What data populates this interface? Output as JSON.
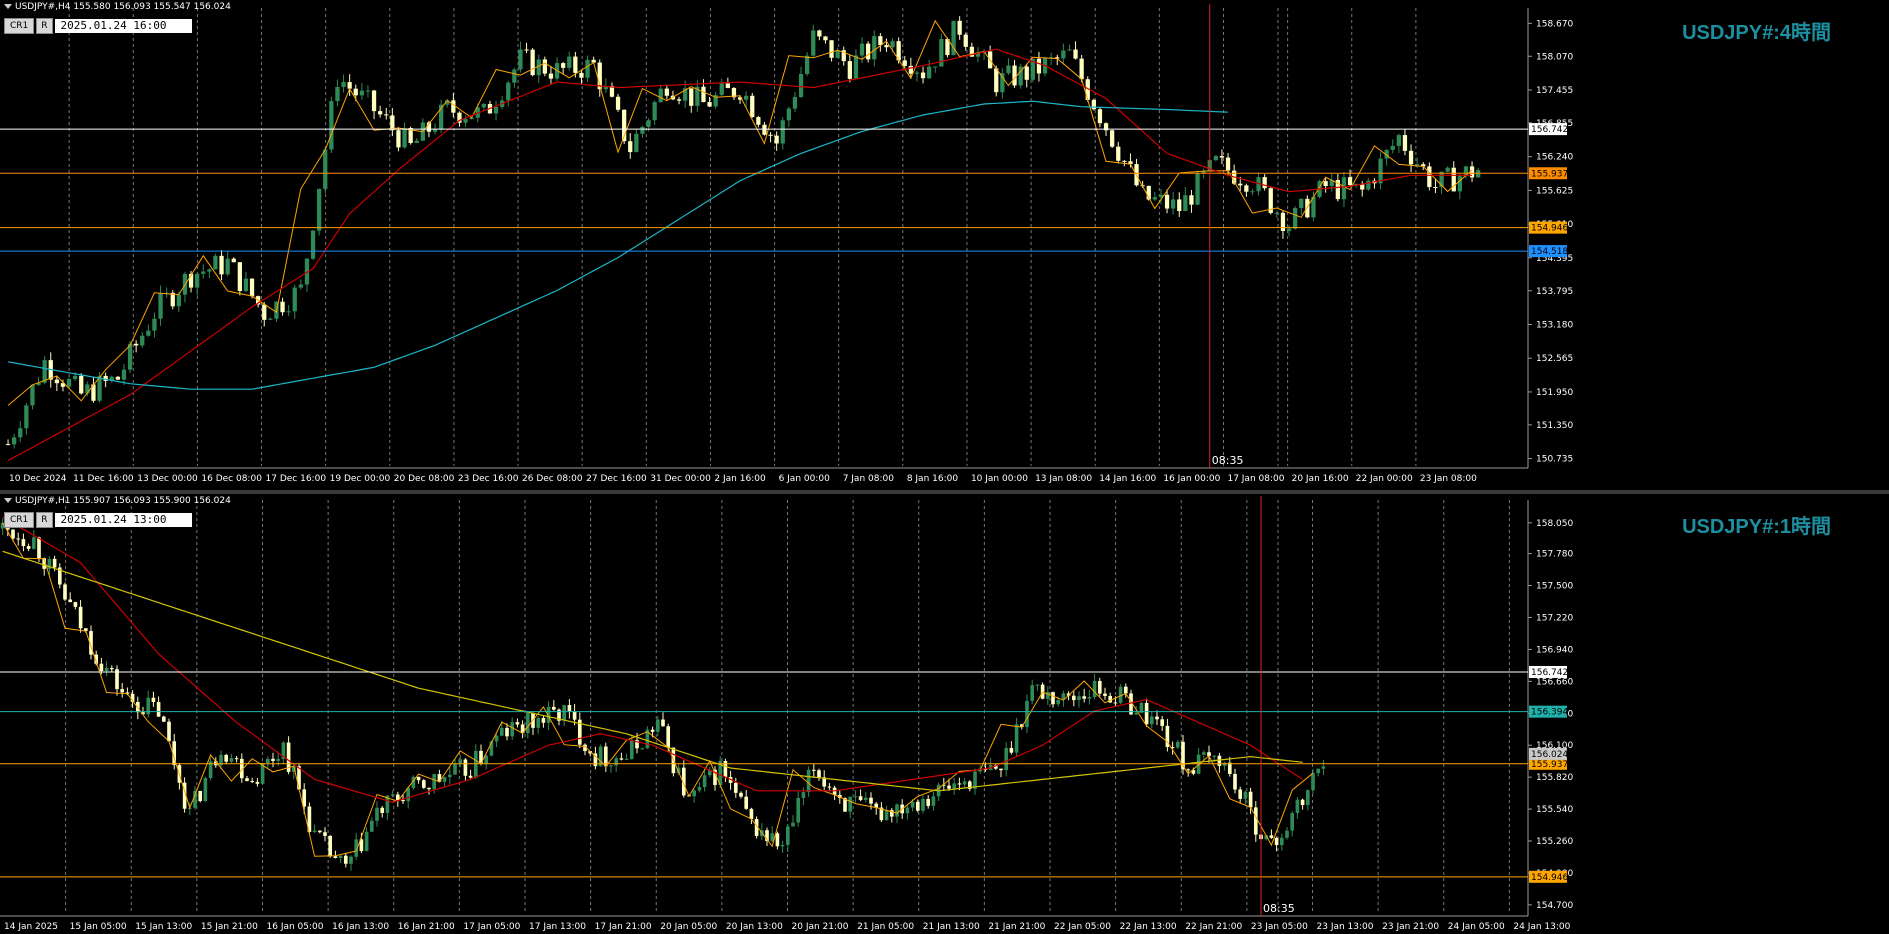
{
  "colors": {
    "bull": "#2e8b57",
    "bear": "#ffffc0",
    "zig": "#ffa500",
    "ma_red": "#cc0000",
    "ma_cyan": "#1bb6c8",
    "ma_yellow": "#d4c400",
    "grid": "#777777",
    "axis_text": "#ffffff",
    "bg": "#000000"
  },
  "h4": {
    "header": "USDJPY#,H4  155.580 156.093 155.547 156.024",
    "cr_label": "CR1",
    "r_label": "R",
    "datetime": "2025.01.24 16:00",
    "title": "USDJPY#:4時間",
    "cursor_time": "08:35"
  },
  "h1": {
    "header": "USDJPY#,H1  155.907 156.093 155.900 156.024",
    "cr_label": "CR1",
    "r_label": "R",
    "datetime": "2025.01.24 13:00",
    "title": "USDJPY#:1時間",
    "cursor_time": "08:35"
  },
  "chart_data": [
    {
      "type": "candlestick",
      "title": "USDJPY#:4時間",
      "timeframe": "H4",
      "ylim": [
        150.6,
        158.95
      ],
      "y_ticks": [
        158.67,
        158.07,
        157.455,
        156.855,
        156.24,
        155.625,
        155.01,
        154.395,
        153.795,
        153.18,
        152.565,
        151.95,
        151.35,
        150.735
      ],
      "x_ticks": [
        "10 Dec 2024",
        "11 Dec 16:00",
        "13 Dec 00:00",
        "16 Dec 08:00",
        "17 Dec 16:00",
        "19 Dec 00:00",
        "20 Dec 08:00",
        "23 Dec 16:00",
        "26 Dec 08:00",
        "27 Dec 16:00",
        "31 Dec 00:00",
        "2 Jan 16:00",
        "6 Jan 00:00",
        "7 Jan 08:00",
        "8 Jan 16:00",
        "10 Jan 00:00",
        "13 Jan 08:00",
        "14 Jan 16:00",
        "16 Jan 00:00",
        "17 Jan 08:00",
        "20 Jan 16:00",
        "22 Jan 00:00",
        "23 Jan 08:00"
      ],
      "levels": [
        {
          "price": 156.742,
          "label": "156.742",
          "color": "#ffffff"
        },
        {
          "price": 155.937,
          "label": "155.937",
          "color": "#ff8c00"
        },
        {
          "price": 154.946,
          "label": "154.946",
          "color": "#ffa500"
        },
        {
          "price": 154.518,
          "label": "154.518",
          "color": "#1e90ff"
        }
      ],
      "close_path": [
        [
          0,
          151.0
        ],
        [
          6,
          152.5
        ],
        [
          12,
          151.9
        ],
        [
          18,
          152.2
        ],
        [
          24,
          153.4
        ],
        [
          30,
          154.1
        ],
        [
          36,
          154.3
        ],
        [
          42,
          153.4
        ],
        [
          48,
          153.8
        ],
        [
          54,
          157.7
        ],
        [
          60,
          157.1
        ],
        [
          66,
          156.4
        ],
        [
          72,
          157.1
        ],
        [
          78,
          157.0
        ],
        [
          84,
          158.0
        ],
        [
          90,
          157.8
        ],
        [
          96,
          157.9
        ],
        [
          102,
          156.4
        ],
        [
          108,
          157.6
        ],
        [
          114,
          157.2
        ],
        [
          120,
          157.5
        ],
        [
          126,
          156.5
        ],
        [
          132,
          158.4
        ],
        [
          138,
          157.9
        ],
        [
          144,
          158.4
        ],
        [
          150,
          157.8
        ],
        [
          156,
          158.6
        ],
        [
          162,
          157.6
        ],
        [
          168,
          157.8
        ],
        [
          174,
          158.1
        ],
        [
          180,
          156.8
        ],
        [
          186,
          155.5
        ],
        [
          192,
          155.3
        ],
        [
          198,
          156.1
        ],
        [
          204,
          155.8
        ],
        [
          210,
          155.0
        ],
        [
          216,
          155.7
        ],
        [
          222,
          155.6
        ],
        [
          228,
          156.6
        ],
        [
          234,
          155.7
        ],
        [
          238,
          155.9
        ],
        [
          241,
          156.0
        ]
      ],
      "n_bars": 242,
      "ma_red": [
        [
          0,
          150.7
        ],
        [
          20,
          151.9
        ],
        [
          40,
          153.5
        ],
        [
          50,
          154.2
        ],
        [
          56,
          155.2
        ],
        [
          64,
          156.0
        ],
        [
          74,
          156.9
        ],
        [
          90,
          157.6
        ],
        [
          100,
          157.5
        ],
        [
          120,
          157.6
        ],
        [
          132,
          157.5
        ],
        [
          150,
          157.9
        ],
        [
          162,
          158.2
        ],
        [
          170,
          157.9
        ],
        [
          180,
          157.3
        ],
        [
          190,
          156.3
        ],
        [
          200,
          155.9
        ],
        [
          210,
          155.6
        ],
        [
          220,
          155.7
        ],
        [
          230,
          155.9
        ],
        [
          240,
          155.9
        ]
      ],
      "ma_cyan": [
        [
          0,
          152.5
        ],
        [
          10,
          152.3
        ],
        [
          20,
          152.1
        ],
        [
          30,
          152.0
        ],
        [
          40,
          152.0
        ],
        [
          50,
          152.2
        ],
        [
          60,
          152.4
        ],
        [
          70,
          152.8
        ],
        [
          80,
          153.3
        ],
        [
          90,
          153.8
        ],
        [
          100,
          154.4
        ],
        [
          110,
          155.1
        ],
        [
          120,
          155.8
        ],
        [
          130,
          156.3
        ],
        [
          140,
          156.7
        ],
        [
          150,
          157.0
        ],
        [
          160,
          157.2
        ],
        [
          168,
          157.25
        ],
        [
          176,
          157.15
        ],
        [
          190,
          157.1
        ],
        [
          200,
          157.05
        ]
      ],
      "cursor_bar": 197,
      "cursor_time": "08:35"
    },
    {
      "type": "candlestick",
      "title": "USDJPY#:1時間",
      "timeframe": "H1",
      "ylim": [
        154.62,
        158.25
      ],
      "y_ticks": [
        158.05,
        157.78,
        157.5,
        157.22,
        156.94,
        156.66,
        156.38,
        156.1,
        155.82,
        155.54,
        155.26,
        154.98,
        154.7
      ],
      "x_ticks": [
        "14 Jan 2025",
        "15 Jan 05:00",
        "15 Jan 13:00",
        "15 Jan 21:00",
        "16 Jan 05:00",
        "16 Jan 13:00",
        "16 Jan 21:00",
        "17 Jan 05:00",
        "17 Jan 13:00",
        "17 Jan 21:00",
        "20 Jan 05:00",
        "20 Jan 13:00",
        "20 Jan 21:00",
        "21 Jan 05:00",
        "21 Jan 13:00",
        "21 Jan 21:00",
        "22 Jan 05:00",
        "22 Jan 13:00",
        "22 Jan 21:00",
        "23 Jan 05:00",
        "23 Jan 13:00",
        "23 Jan 21:00",
        "24 Jan 05:00",
        "24 Jan 13:00"
      ],
      "levels": [
        {
          "price": 156.742,
          "label": "156.742",
          "color": "#ffffff"
        },
        {
          "price": 156.394,
          "label": "156.394",
          "color": "#20b2aa"
        },
        {
          "price": 155.937,
          "label": "155.937",
          "color": "#ffa500"
        },
        {
          "price": 154.946,
          "label": "154.946",
          "color": "#ffa500"
        }
      ],
      "current_price": "156.024",
      "close_path": [
        [
          0,
          158.0
        ],
        [
          6,
          157.9
        ],
        [
          12,
          157.4
        ],
        [
          18,
          156.9
        ],
        [
          24,
          156.5
        ],
        [
          30,
          156.4
        ],
        [
          36,
          155.5
        ],
        [
          42,
          156.1
        ],
        [
          48,
          155.8
        ],
        [
          54,
          156.1
        ],
        [
          60,
          155.3
        ],
        [
          66,
          155.0
        ],
        [
          72,
          155.5
        ],
        [
          78,
          155.7
        ],
        [
          84,
          155.8
        ],
        [
          90,
          155.9
        ],
        [
          96,
          156.2
        ],
        [
          102,
          156.3
        ],
        [
          108,
          156.4
        ],
        [
          114,
          156.0
        ],
        [
          120,
          156.0
        ],
        [
          126,
          156.3
        ],
        [
          132,
          155.6
        ],
        [
          138,
          155.9
        ],
        [
          144,
          155.4
        ],
        [
          150,
          155.2
        ],
        [
          156,
          155.9
        ],
        [
          162,
          155.6
        ],
        [
          168,
          155.5
        ],
        [
          174,
          155.6
        ],
        [
          180,
          155.7
        ],
        [
          186,
          155.8
        ],
        [
          192,
          155.9
        ],
        [
          198,
          156.6
        ],
        [
          204,
          156.5
        ],
        [
          210,
          156.6
        ],
        [
          216,
          156.5
        ],
        [
          222,
          156.3
        ],
        [
          228,
          155.9
        ],
        [
          234,
          156.0
        ],
        [
          240,
          155.5
        ],
        [
          244,
          155.2
        ],
        [
          250,
          155.6
        ],
        [
          254,
          156.0
        ]
      ],
      "n_bars": 255,
      "ma_red": [
        [
          0,
          158.1
        ],
        [
          15,
          157.7
        ],
        [
          30,
          156.9
        ],
        [
          45,
          156.3
        ],
        [
          60,
          155.8
        ],
        [
          75,
          155.6
        ],
        [
          90,
          155.8
        ],
        [
          105,
          156.1
        ],
        [
          115,
          156.2
        ],
        [
          125,
          156.1
        ],
        [
          135,
          155.9
        ],
        [
          145,
          155.7
        ],
        [
          160,
          155.7
        ],
        [
          175,
          155.8
        ],
        [
          190,
          155.9
        ],
        [
          200,
          156.1
        ],
        [
          210,
          156.4
        ],
        [
          220,
          156.5
        ],
        [
          230,
          156.3
        ],
        [
          240,
          156.1
        ],
        [
          250,
          155.8
        ]
      ],
      "ma_yellow": [
        [
          0,
          157.8
        ],
        [
          20,
          157.5
        ],
        [
          40,
          157.2
        ],
        [
          60,
          156.9
        ],
        [
          80,
          156.6
        ],
        [
          100,
          156.4
        ],
        [
          120,
          156.2
        ],
        [
          140,
          155.9
        ],
        [
          160,
          155.8
        ],
        [
          180,
          155.7
        ],
        [
          200,
          155.8
        ],
        [
          220,
          155.9
        ],
        [
          240,
          156.0
        ],
        [
          250,
          155.95
        ]
      ],
      "cursor_bar": 242,
      "cursor_time": "08:35"
    }
  ]
}
